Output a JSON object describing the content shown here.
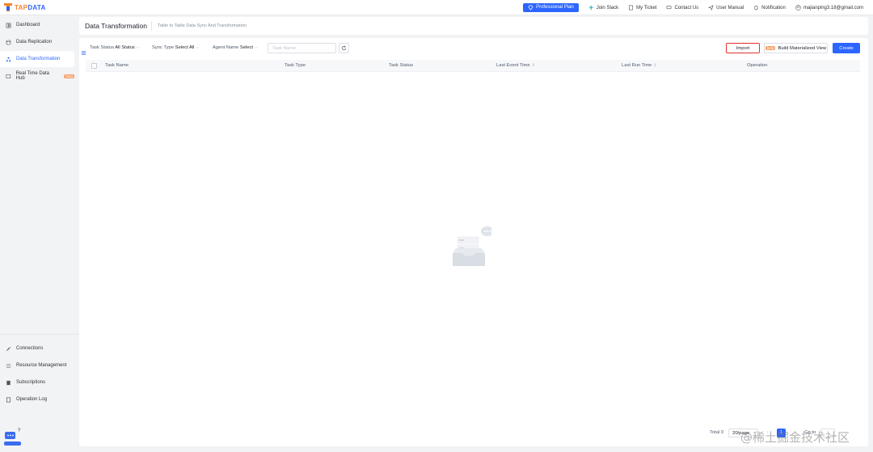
{
  "brand": {
    "logo_text_a": "TAP",
    "logo_text_b": "DATA"
  },
  "topnav": {
    "plan": "Professional Plan",
    "join_slack": "Join Slack",
    "my_ticket": "My Ticket",
    "contact_us": "Contact Us",
    "user_manual": "User Manual",
    "notification": "Notification",
    "user": "majianping3.18@gmail.com"
  },
  "sidebar": {
    "items": [
      {
        "label": "Dashboard",
        "icon": "dashboard-icon"
      },
      {
        "label": "Data Replication",
        "icon": "database-icon"
      },
      {
        "label": "Data Transformation",
        "icon": "transform-icon",
        "active": true
      },
      {
        "label": "Real Time Data Hub",
        "icon": "hub-icon",
        "badge": "beta"
      }
    ],
    "bottom_items": [
      {
        "label": "Connections",
        "icon": "connection-icon"
      },
      {
        "label": "Resource Management",
        "icon": "resource-icon"
      },
      {
        "label": "Subscriptions",
        "icon": "subscription-icon"
      },
      {
        "label": "Operation Log",
        "icon": "log-icon"
      }
    ],
    "chat_badge": "?"
  },
  "header": {
    "title": "Data Transformation",
    "subtitle": "Table to Table Data Sync And Transformation"
  },
  "filters": {
    "task_status_label": "Task Status",
    "task_status_value": "All Status",
    "sync_type_label": "Sync Type",
    "sync_type_value": "Select All",
    "agent_name_label": "Agent Name",
    "agent_name_value": "Select",
    "search_placeholder": "Task Name"
  },
  "actions": {
    "import": "Import",
    "build_view": "Build Materialized View",
    "build_badge": "beta",
    "create": "Create"
  },
  "table": {
    "columns": [
      "Task Name",
      "Task Type",
      "Task Status",
      "Last Event Time",
      "Last Run Time",
      "Operation"
    ],
    "rows": []
  },
  "pagination": {
    "total": "Total 0",
    "page_size": "20/page",
    "current_page": "1",
    "goto_label": "Go to"
  },
  "watermark": "@稀土掘金技术社区",
  "colors": {
    "accent": "#2c65ff",
    "brand_orange": "#f5842c",
    "highlight_border": "#e0322b"
  }
}
